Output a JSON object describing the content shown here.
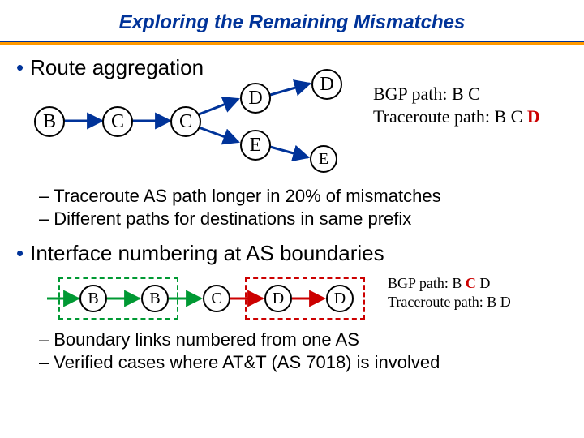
{
  "title": "Exploring the Remaining Mismatches",
  "section1": {
    "heading": "Route aggregation",
    "nodes": {
      "b": "B",
      "c1": "C",
      "c2": "C",
      "d1": "D",
      "e1": "E",
      "d2": "D",
      "e2": "E"
    },
    "path1_label": "BGP path: B C",
    "path2_prefix": "Traceroute path: B C ",
    "path2_em": "D",
    "sub1": "Traceroute AS path longer in 20% of mismatches",
    "sub2": "Different paths for destinations in same prefix"
  },
  "section2": {
    "heading": "Interface numbering at AS boundaries",
    "nodes": {
      "b1": "B",
      "b2": "B",
      "c": "C",
      "d1": "D",
      "d2": "D"
    },
    "path1_prefix": "BGP path: B ",
    "path1_em": "C",
    "path1_suffix": " D",
    "path2_label": "Traceroute path: B D",
    "sub1": "Boundary links numbered from one AS",
    "sub2": "Verified cases where AT&T (AS 7018) is involved"
  },
  "colors": {
    "title": "#003399",
    "accent": "#ff9900",
    "arrow": "#003399",
    "arrow_red": "#cc0000",
    "arrow_green": "#009933"
  }
}
